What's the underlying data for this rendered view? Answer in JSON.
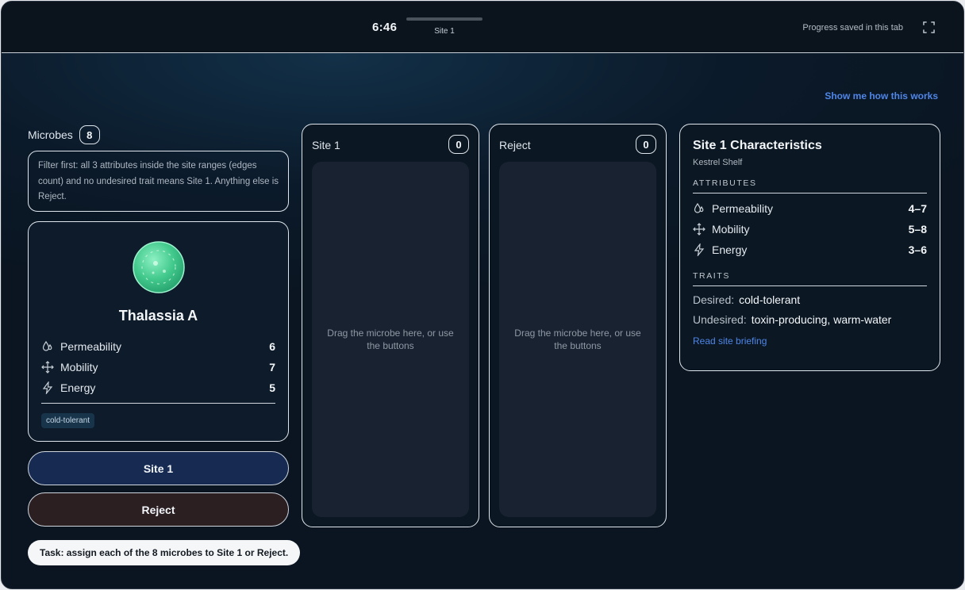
{
  "topbar": {
    "timer": "6:46",
    "site_label": "Site 1",
    "saved_text": "Progress saved in this tab"
  },
  "help_link": "Show me how this works",
  "microbes": {
    "title": "Microbes",
    "count": "8",
    "hint": "Filter first: all 3 attributes inside the site ranges (edges count) and no undesired trait means Site 1. Anything else is Reject."
  },
  "current_microbe": {
    "name": "Thalassia A",
    "attributes": [
      {
        "label": "Permeability",
        "value": "6",
        "icon": "droplet-icon"
      },
      {
        "label": "Mobility",
        "value": "7",
        "icon": "move-arrows-icon"
      },
      {
        "label": "Energy",
        "value": "5",
        "icon": "lightning-icon"
      }
    ],
    "tags": [
      "cold-tolerant"
    ]
  },
  "buttons": {
    "site": "Site 1",
    "reject": "Reject"
  },
  "task": "Task: assign each of the 8 microbes to Site 1 or Reject.",
  "zones": [
    {
      "title": "Site 1",
      "count": "0",
      "placeholder": "Drag the microbe here, or use the buttons"
    },
    {
      "title": "Reject",
      "count": "0",
      "placeholder": "Drag the microbe here, or use the buttons"
    }
  ],
  "characteristics": {
    "title": "Site 1 Characteristics",
    "subtitle": "Kestrel Shelf",
    "attributes_heading": "ATTRIBUTES",
    "attributes": [
      {
        "label": "Permeability",
        "range": "4–7",
        "icon": "droplet-icon"
      },
      {
        "label": "Mobility",
        "range": "5–8",
        "icon": "move-arrows-icon"
      },
      {
        "label": "Energy",
        "range": "3–6",
        "icon": "lightning-icon"
      }
    ],
    "traits_heading": "TRAITS",
    "desired_label": "Desired:",
    "desired_value": "cold-tolerant",
    "undesired_label": "Undesired:",
    "undesired_value": "toxin-producing, warm-water",
    "briefing_link": "Read site briefing"
  },
  "colors": {
    "accent_link": "#4f86e8",
    "site_button": "#172b52",
    "reject_button": "#2b1f22",
    "microbe": "#4fd39a"
  }
}
